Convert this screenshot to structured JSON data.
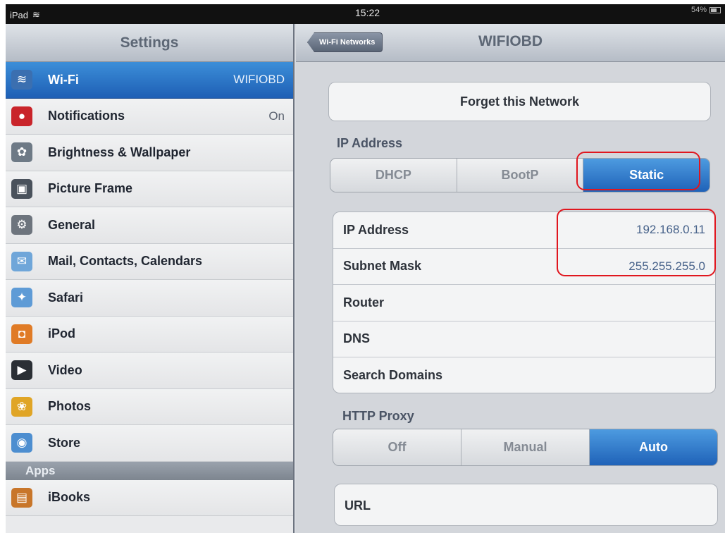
{
  "status_bar": {
    "device": "iPad",
    "time": "15:22",
    "battery": "54%"
  },
  "left_panel": {
    "title": "Settings",
    "items": [
      {
        "label": "Wi-Fi",
        "value": "WIFIOBD",
        "icon": "wifi-icon",
        "color": "#3b6fb0"
      },
      {
        "label": "Notifications",
        "value": "On",
        "icon": "notifications-icon",
        "color": "#c9242a"
      },
      {
        "label": "Brightness & Wallpaper",
        "value": "",
        "icon": "flower-icon",
        "color": "#6e7a86"
      },
      {
        "label": "Picture Frame",
        "value": "",
        "icon": "picture-frame-icon",
        "color": "#4a525c"
      },
      {
        "label": "General",
        "value": "",
        "icon": "gear-icon",
        "color": "#6d747d"
      },
      {
        "label": "Mail, Contacts, Calendars",
        "value": "",
        "icon": "mail-icon",
        "color": "#6fa6d9"
      },
      {
        "label": "Safari",
        "value": "",
        "icon": "compass-icon",
        "color": "#5e9bd6"
      },
      {
        "label": "iPod",
        "value": "",
        "icon": "ipod-icon",
        "color": "#e07b26"
      },
      {
        "label": "Video",
        "value": "",
        "icon": "video-icon",
        "color": "#2b2f35"
      },
      {
        "label": "Photos",
        "value": "",
        "icon": "sunflower-icon",
        "color": "#e0a526"
      },
      {
        "label": "Store",
        "value": "",
        "icon": "store-icon",
        "color": "#4d8ed0"
      }
    ],
    "apps_header": "Apps",
    "apps": [
      {
        "label": "iBooks",
        "value": "",
        "icon": "ibooks-icon",
        "color": "#c8762a"
      }
    ]
  },
  "right_panel": {
    "back_label": "Wi-Fi Networks",
    "title": "WIFIOBD",
    "forget_label": "Forget this Network",
    "ip_section": "IP Address",
    "ip_modes": [
      "DHCP",
      "BootP",
      "Static"
    ],
    "ip_selected": "Static",
    "fields": [
      {
        "key": "IP Address",
        "value": "192.168.0.11"
      },
      {
        "key": "Subnet Mask",
        "value": "255.255.255.0"
      },
      {
        "key": "Router",
        "value": ""
      },
      {
        "key": "DNS",
        "value": ""
      },
      {
        "key": "Search Domains",
        "value": ""
      }
    ],
    "proxy_section": "HTTP Proxy",
    "proxy_modes": [
      "Off",
      "Manual",
      "Auto"
    ],
    "proxy_selected": "Auto",
    "url_label": "URL"
  },
  "colors": {
    "accent": "#2a72c8",
    "highlight": "#e0161e"
  }
}
